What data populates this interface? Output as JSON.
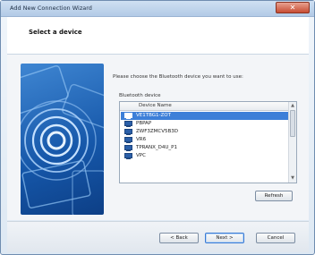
{
  "window": {
    "title": "Add New Connection Wizard",
    "close_label": "✕"
  },
  "header": {
    "title": "Select a device"
  },
  "content": {
    "instruction": "Please choose the Bluetooth device you want to use:",
    "list_label": "Bluetooth device",
    "column_header": "Device Name",
    "devices": [
      {
        "name": "VE1TBG1-ZOT",
        "selected": true
      },
      {
        "name": "PBPAP",
        "selected": false
      },
      {
        "name": "ZWF3ZMCV5B3D",
        "selected": false
      },
      {
        "name": "VR6",
        "selected": false
      },
      {
        "name": "TPRANX_D4U_P1",
        "selected": false
      },
      {
        "name": "VPC",
        "selected": false
      }
    ],
    "refresh_label": "Refresh"
  },
  "footer": {
    "back_label": "< Back",
    "next_label": "Next >",
    "cancel_label": "Cancel"
  },
  "colors": {
    "selection": "#3d7fd8",
    "illustration": "#1556a8",
    "close_button": "#c74c33"
  }
}
